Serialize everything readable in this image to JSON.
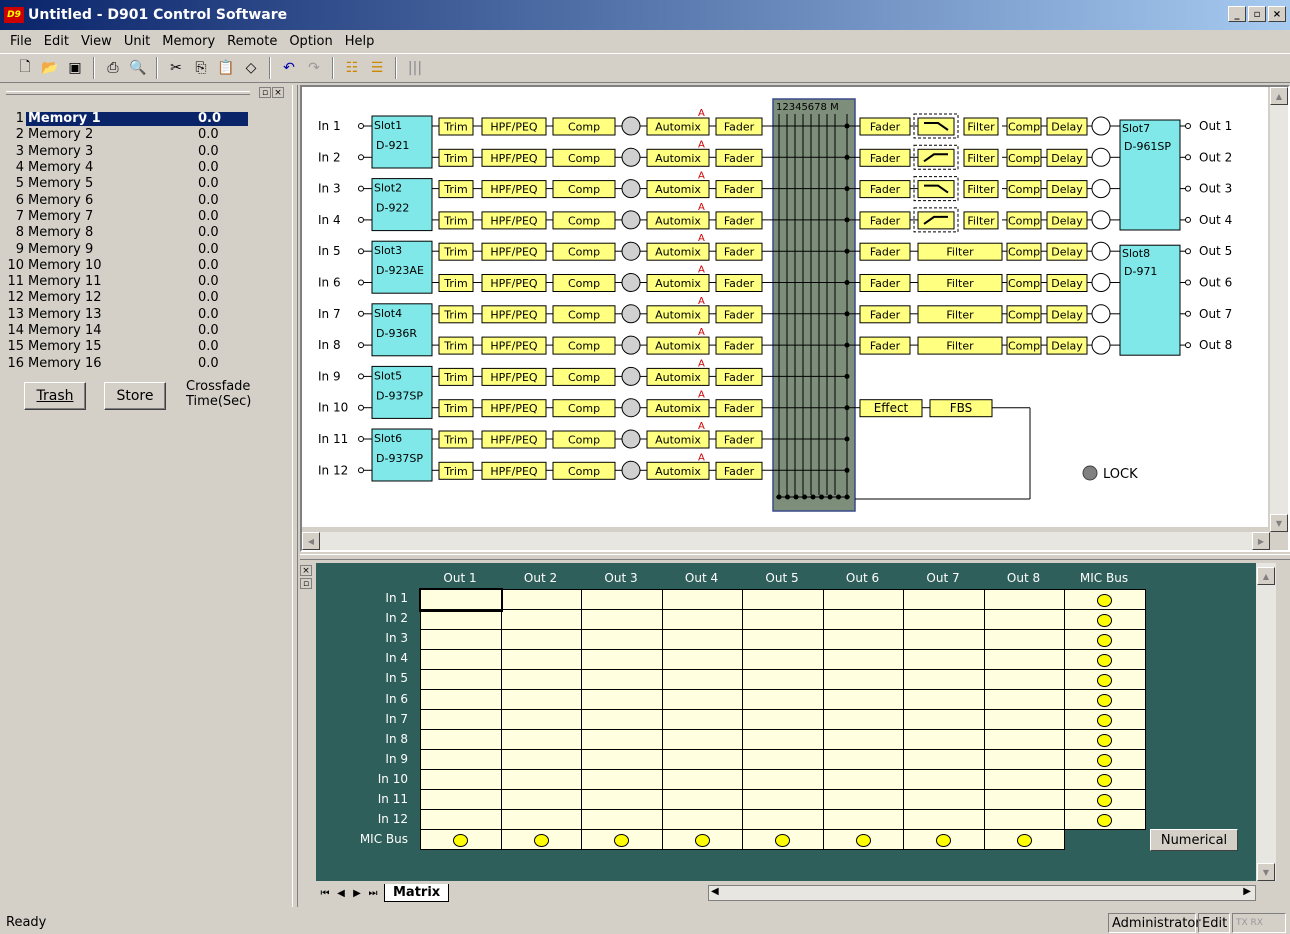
{
  "window": {
    "title": "Untitled - D901 Control Software",
    "icon": "d901-app-icon"
  },
  "menu": [
    "File",
    "Edit",
    "View",
    "Unit",
    "Memory",
    "Remote",
    "Option",
    "Help"
  ],
  "toolbar": [
    "new-icon",
    "open-icon",
    "save-icon",
    "print-icon",
    "print-preview-icon",
    "cut-icon",
    "copy-icon",
    "paste-icon",
    "eraser-icon",
    "undo-icon",
    "redo-icon",
    "layout-a-icon",
    "layout-b-icon",
    "meter-icon"
  ],
  "memory": {
    "items": [
      {
        "num": "1",
        "name": "Memory 1",
        "value": "0.0"
      },
      {
        "num": "2",
        "name": "Memory 2",
        "value": "0.0"
      },
      {
        "num": "3",
        "name": "Memory 3",
        "value": "0.0"
      },
      {
        "num": "4",
        "name": "Memory 4",
        "value": "0.0"
      },
      {
        "num": "5",
        "name": "Memory 5",
        "value": "0.0"
      },
      {
        "num": "6",
        "name": "Memory 6",
        "value": "0.0"
      },
      {
        "num": "7",
        "name": "Memory 7",
        "value": "0.0"
      },
      {
        "num": "8",
        "name": "Memory 8",
        "value": "0.0"
      },
      {
        "num": "9",
        "name": "Memory 9",
        "value": "0.0"
      },
      {
        "num": "10",
        "name": "Memory 10",
        "value": "0.0"
      },
      {
        "num": "11",
        "name": "Memory 11",
        "value": "0.0"
      },
      {
        "num": "12",
        "name": "Memory 12",
        "value": "0.0"
      },
      {
        "num": "13",
        "name": "Memory 13",
        "value": "0.0"
      },
      {
        "num": "14",
        "name": "Memory 14",
        "value": "0.0"
      },
      {
        "num": "15",
        "name": "Memory 15",
        "value": "0.0"
      },
      {
        "num": "16",
        "name": "Memory 16",
        "value": "0.0"
      }
    ],
    "trash_label": "Trash",
    "store_label": "Store",
    "crossfade_line1": "Crossfade",
    "crossfade_line2": "Time(Sec)"
  },
  "diagram": {
    "inputs": [
      "In 1",
      "In 2",
      "In 3",
      "In 4",
      "In 5",
      "In 6",
      "In 7",
      "In 8",
      "In 9",
      "In 10",
      "In 11",
      "In 12"
    ],
    "outputs": [
      "Out 1",
      "Out 2",
      "Out 3",
      "Out 4",
      "Out 5",
      "Out 6",
      "Out 7",
      "Out 8"
    ],
    "input_slots": [
      {
        "slot": "Slot1",
        "model": "D-921"
      },
      {
        "slot": "Slot2",
        "model": "D-922"
      },
      {
        "slot": "Slot3",
        "model": "D-923AE"
      },
      {
        "slot": "Slot4",
        "model": "D-936R"
      },
      {
        "slot": "Slot5",
        "model": "D-937SP"
      },
      {
        "slot": "Slot6",
        "model": "D-937SP"
      }
    ],
    "output_slots": [
      {
        "slot": "Slot7",
        "model": "D-961SP"
      },
      {
        "slot": "Slot8",
        "model": "D-971"
      }
    ],
    "chain": {
      "trim": "Trim",
      "hpf": "HPF/PEQ",
      "comp": "Comp",
      "automix": "Automix",
      "automix_flag": "A",
      "fader": "Fader"
    },
    "out_chain": {
      "fader": "Fader",
      "filter": "Filter",
      "comp": "Comp",
      "delay": "Delay"
    },
    "matrix_header": "12345678 M",
    "effect": "Effect",
    "fbs": "FBS",
    "lock": "LOCK"
  },
  "matrix": {
    "columns": [
      "Out 1",
      "Out 2",
      "Out 3",
      "Out 4",
      "Out 5",
      "Out 6",
      "Out 7",
      "Out 8",
      "MIC Bus"
    ],
    "rows": [
      "In 1",
      "In 2",
      "In 3",
      "In 4",
      "In 5",
      "In 6",
      "In 7",
      "In 8",
      "In 9",
      "In 10",
      "In 11",
      "In 12",
      "MIC Bus"
    ],
    "numerical_label": "Numerical",
    "tab": "Matrix"
  },
  "status": {
    "text": "Ready",
    "user": "Administrator",
    "mode": "Edit",
    "txrx": "TX RX"
  },
  "colors": {
    "slot": "#80e8e8",
    "block": "#ffff80",
    "matrix_bg": "#2f5f5a",
    "cell": "#ffffe0",
    "title_start": "#0a246a"
  }
}
